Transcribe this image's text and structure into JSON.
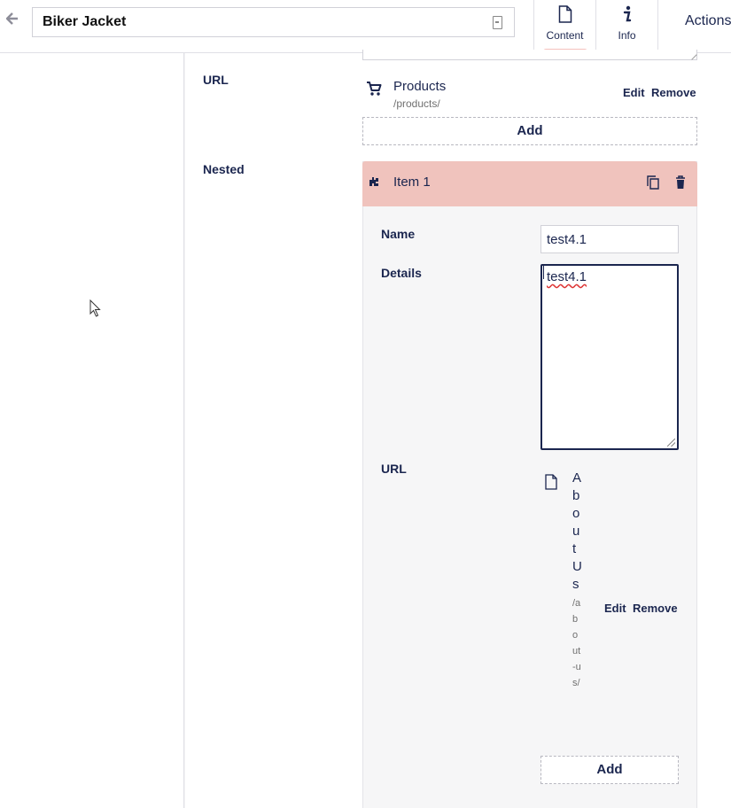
{
  "header": {
    "back_icon": "arrow-left-icon",
    "node_name": "Biker Jacket",
    "tabs": [
      {
        "label": "Content",
        "icon": "document-icon",
        "active": true
      },
      {
        "label": "Info",
        "icon": "info-icon",
        "active": false
      }
    ],
    "actions_label": "Actions"
  },
  "main": {
    "url_property": {
      "label": "URL",
      "link": {
        "icon": "cart-icon",
        "title": "Products",
        "path": "/products/",
        "edit_label": "Edit",
        "remove_label": "Remove"
      },
      "add_label": "Add"
    },
    "nested_property": {
      "label": "Nested",
      "item": {
        "title": "Item 1",
        "fields": {
          "name": {
            "label": "Name",
            "value": "test4.1"
          },
          "details": {
            "label": "Details",
            "value": "test4.1"
          },
          "url": {
            "label": "URL",
            "link": {
              "icon": "document-icon",
              "title": "About Us",
              "path": "/about-us/",
              "edit_label": "Edit",
              "remove_label": "Remove"
            },
            "add_label": "Add"
          }
        }
      }
    }
  },
  "colors": {
    "primary": "#1b264f",
    "accent_pink": "#f0c3bd",
    "tab_underline": "#f5c1bc"
  }
}
